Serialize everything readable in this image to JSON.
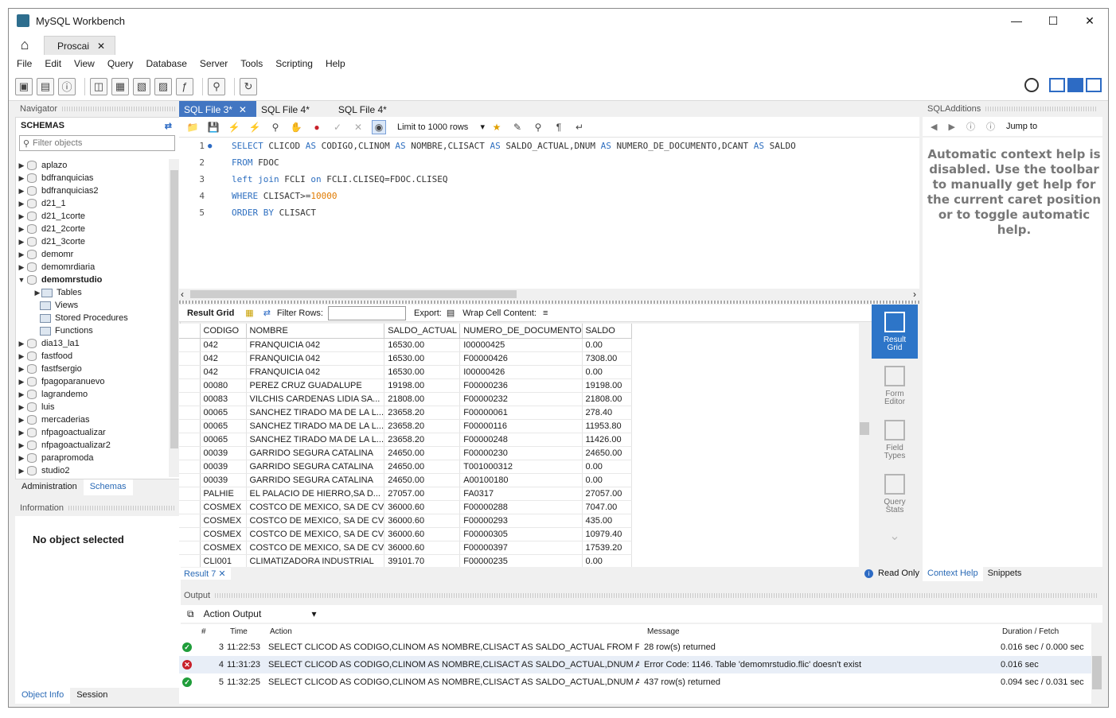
{
  "window": {
    "title": "MySQL Workbench"
  },
  "connection_tab": {
    "label": "Proscai"
  },
  "menu": [
    "File",
    "Edit",
    "View",
    "Query",
    "Database",
    "Server",
    "Tools",
    "Scripting",
    "Help"
  ],
  "navigator": {
    "title": "Navigator",
    "schemas_label": "SCHEMAS",
    "filter_placeholder": "Filter objects",
    "schemas": [
      "aplazo",
      "bdfranquicias",
      "bdfranquicias2",
      "d21_1",
      "d21_1corte",
      "d21_2corte",
      "d21_3corte",
      "demomr",
      "demomrdiaria",
      "demomrstudio",
      "dia13_la1",
      "fastfood",
      "fastfsergio",
      "fpagoparanuevo",
      "lagrandemo",
      "luis",
      "mercaderias",
      "nfpagoactualizar",
      "nfpagoactualizar2",
      "parapromoda",
      "studio2"
    ],
    "expanded_schema": "demomrstudio",
    "expanded_children": [
      "Tables",
      "Views",
      "Stored Procedures",
      "Functions"
    ],
    "tabs": [
      "Administration",
      "Schemas"
    ],
    "active_tab": "Schemas"
  },
  "information": {
    "title": "Information",
    "text": "No object selected"
  },
  "bottom_tabs": [
    "Object Info",
    "Session"
  ],
  "editor": {
    "tabs": [
      "SQL File 3*",
      "SQL File 4*",
      "SQL File 4*"
    ],
    "active_tab": "SQL File 3*",
    "limit_label": "Limit to 1000 rows",
    "line_numbers": [
      "1",
      "2",
      "3",
      "4",
      "5"
    ]
  },
  "result": {
    "result_grid_label": "Result Grid",
    "filter_rows_label": "Filter Rows:",
    "export_label": "Export:",
    "wrap_label": "Wrap Cell Content:",
    "columns": [
      "CODIGO",
      "NOMBRE",
      "SALDO_ACTUAL",
      "NUMERO_DE_DOCUMENTO",
      "SALDO"
    ],
    "rows": [
      [
        "042",
        "FRANQUICIA 042",
        "16530.00",
        "I00000425",
        "0.00"
      ],
      [
        "042",
        "FRANQUICIA 042",
        "16530.00",
        "F00000426",
        "7308.00"
      ],
      [
        "042",
        "FRANQUICIA 042",
        "16530.00",
        "I00000426",
        "0.00"
      ],
      [
        "00080",
        "PEREZ CRUZ GUADALUPE",
        "19198.00",
        "F00000236",
        "19198.00"
      ],
      [
        "00083",
        "VILCHIS CARDENAS LIDIA SA...",
        "21808.00",
        "F00000232",
        "21808.00"
      ],
      [
        "00065",
        "SANCHEZ TIRADO MA DE LA L...",
        "23658.20",
        "F00000061",
        "278.40"
      ],
      [
        "00065",
        "SANCHEZ TIRADO MA DE LA L...",
        "23658.20",
        "F00000116",
        "11953.80"
      ],
      [
        "00065",
        "SANCHEZ TIRADO MA DE LA L...",
        "23658.20",
        "F00000248",
        "11426.00"
      ],
      [
        "00039",
        "GARRIDO SEGURA CATALINA",
        "24650.00",
        "F00000230",
        "24650.00"
      ],
      [
        "00039",
        "GARRIDO SEGURA CATALINA",
        "24650.00",
        "T001000312",
        "0.00"
      ],
      [
        "00039",
        "GARRIDO SEGURA CATALINA",
        "24650.00",
        "A00100180",
        "0.00"
      ],
      [
        "PALHIE",
        "EL PALACIO DE HIERRO,SA D...",
        "27057.00",
        "FA0317",
        "27057.00"
      ],
      [
        "COSMEX",
        "COSTCO DE MEXICO, SA DE CV",
        "36000.60",
        "F00000288",
        "7047.00"
      ],
      [
        "COSMEX",
        "COSTCO DE MEXICO, SA DE CV",
        "36000.60",
        "F00000293",
        "435.00"
      ],
      [
        "COSMEX",
        "COSTCO DE MEXICO, SA DE CV",
        "36000.60",
        "F00000305",
        "10979.40"
      ],
      [
        "COSMEX",
        "COSTCO DE MEXICO, SA DE CV",
        "36000.60",
        "F00000397",
        "17539.20"
      ],
      [
        "CLI001",
        "CLIMATIZADORA INDUSTRIAL",
        "39101.70",
        "F00000235",
        "0.00"
      ]
    ],
    "side_buttons": [
      {
        "label1": "Result",
        "label2": "Grid"
      },
      {
        "label1": "Form",
        "label2": "Editor"
      },
      {
        "label1": "Field",
        "label2": "Types"
      },
      {
        "label1": "Query",
        "label2": "Stats"
      }
    ],
    "result_tab": "Result 7",
    "read_only": "Read Only"
  },
  "sql_additions": {
    "title": "SQLAdditions",
    "jump_to": "Jump to",
    "help_text": "Automatic context help is disabled. Use the toolbar to manually get help for the current caret position or to toggle automatic help.",
    "tabs": [
      "Context Help",
      "Snippets"
    ]
  },
  "output": {
    "title": "Output",
    "selector": "Action Output",
    "headers": [
      "#",
      "Time",
      "Action",
      "Message",
      "Duration / Fetch"
    ],
    "rows": [
      {
        "status": "ok",
        "num": "3",
        "time": "11:22:53",
        "action": "SELECT CLICOD AS CODIGO,CLINOM AS NOMBRE,CLISACT AS SALDO_ACTUAL FROM F...",
        "message": "28 row(s) returned",
        "duration": "0.016 sec / 0.000 sec"
      },
      {
        "status": "err",
        "num": "4",
        "time": "11:31:23",
        "action": "SELECT CLICOD AS CODIGO,CLINOM AS NOMBRE,CLISACT AS SALDO_ACTUAL,DNUM A...",
        "message": "Error Code: 1146. Table 'demomrstudio.flic' doesn't exist",
        "duration": "0.016 sec"
      },
      {
        "status": "ok",
        "num": "5",
        "time": "11:32:25",
        "action": "SELECT CLICOD AS CODIGO,CLINOM AS NOMBRE,CLISACT AS SALDO_ACTUAL,DNUM A...",
        "message": "437 row(s) returned",
        "duration": "0.094 sec / 0.031 sec"
      }
    ]
  }
}
